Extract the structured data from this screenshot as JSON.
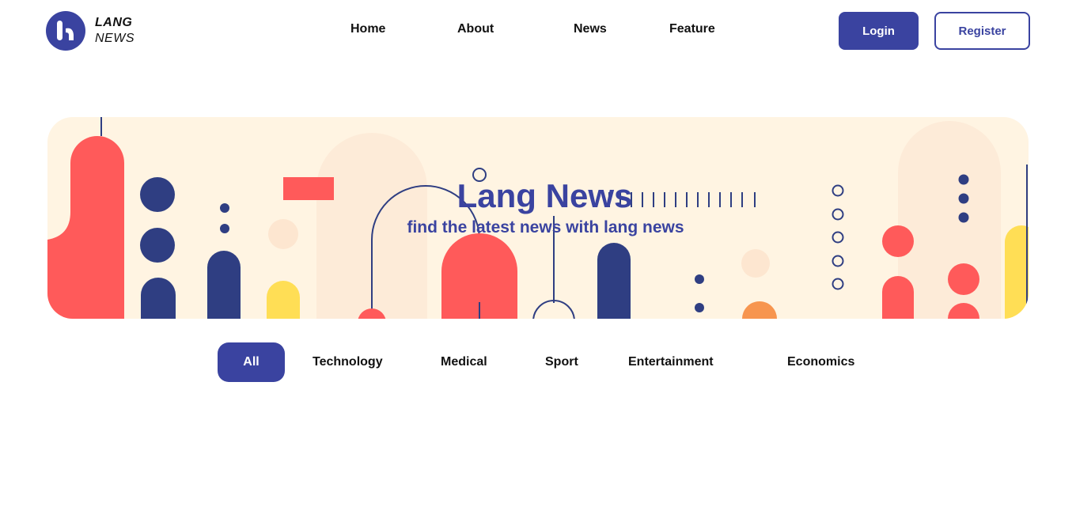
{
  "brand": {
    "name_line1": "LANG",
    "name_line2": "NEWS",
    "logo_icon": "lang-logo-icon",
    "accent_color": "#3a43a0"
  },
  "nav": {
    "items": [
      {
        "label": "Home"
      },
      {
        "label": "About"
      },
      {
        "label": "News"
      },
      {
        "label": "Feature"
      }
    ]
  },
  "auth": {
    "login_label": "Login",
    "register_label": "Register"
  },
  "hero": {
    "title": "Lang News",
    "subtitle": "find the latest news with lang news",
    "background_color": "#fff4e2",
    "palette": {
      "red": "#ff5a5a",
      "navy": "#2f3e82",
      "yellow": "#ffde55",
      "orange": "#f7954f"
    }
  },
  "categories": {
    "items": [
      {
        "label": "All",
        "active": true
      },
      {
        "label": "Technology"
      },
      {
        "label": "Medical"
      },
      {
        "label": "Sport"
      },
      {
        "label": "Entertainment"
      },
      {
        "label": "Economics"
      }
    ]
  }
}
